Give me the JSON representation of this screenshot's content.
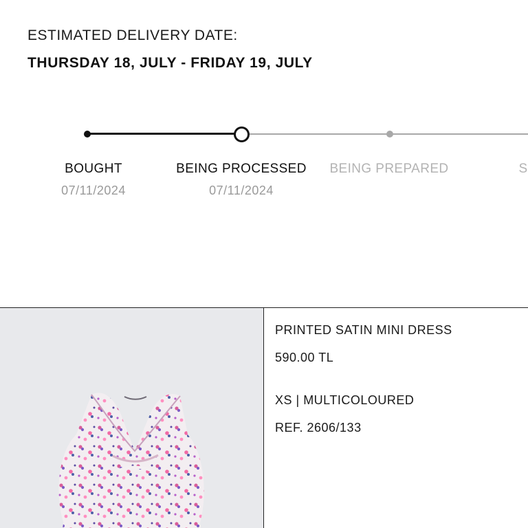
{
  "delivery": {
    "label": "ESTIMATED DELIVERY DATE:",
    "dates": "THURSDAY 18, JULY - FRIDAY 19, JULY"
  },
  "tracking": {
    "steps": [
      {
        "label": "BOUGHT",
        "date": "07/11/2024",
        "status": "done"
      },
      {
        "label": "BEING PROCESSED",
        "date": "07/11/2024",
        "status": "current"
      },
      {
        "label": "BEING PREPARED",
        "date": "",
        "status": "pending"
      },
      {
        "label": "S",
        "date": "",
        "status": "pending"
      }
    ]
  },
  "product": {
    "name": "PRINTED SATIN MINI DRESS",
    "price": "590.00 TL",
    "variant": "XS | MULTICOLOURED",
    "reference": "REF. 2606/133",
    "image_icon": "floral-dress-photo"
  },
  "colors": {
    "text": "#111111",
    "inactive": "#b3b3b3",
    "date_gray": "#9a9a9a",
    "image_background": "#e8e9ec"
  }
}
